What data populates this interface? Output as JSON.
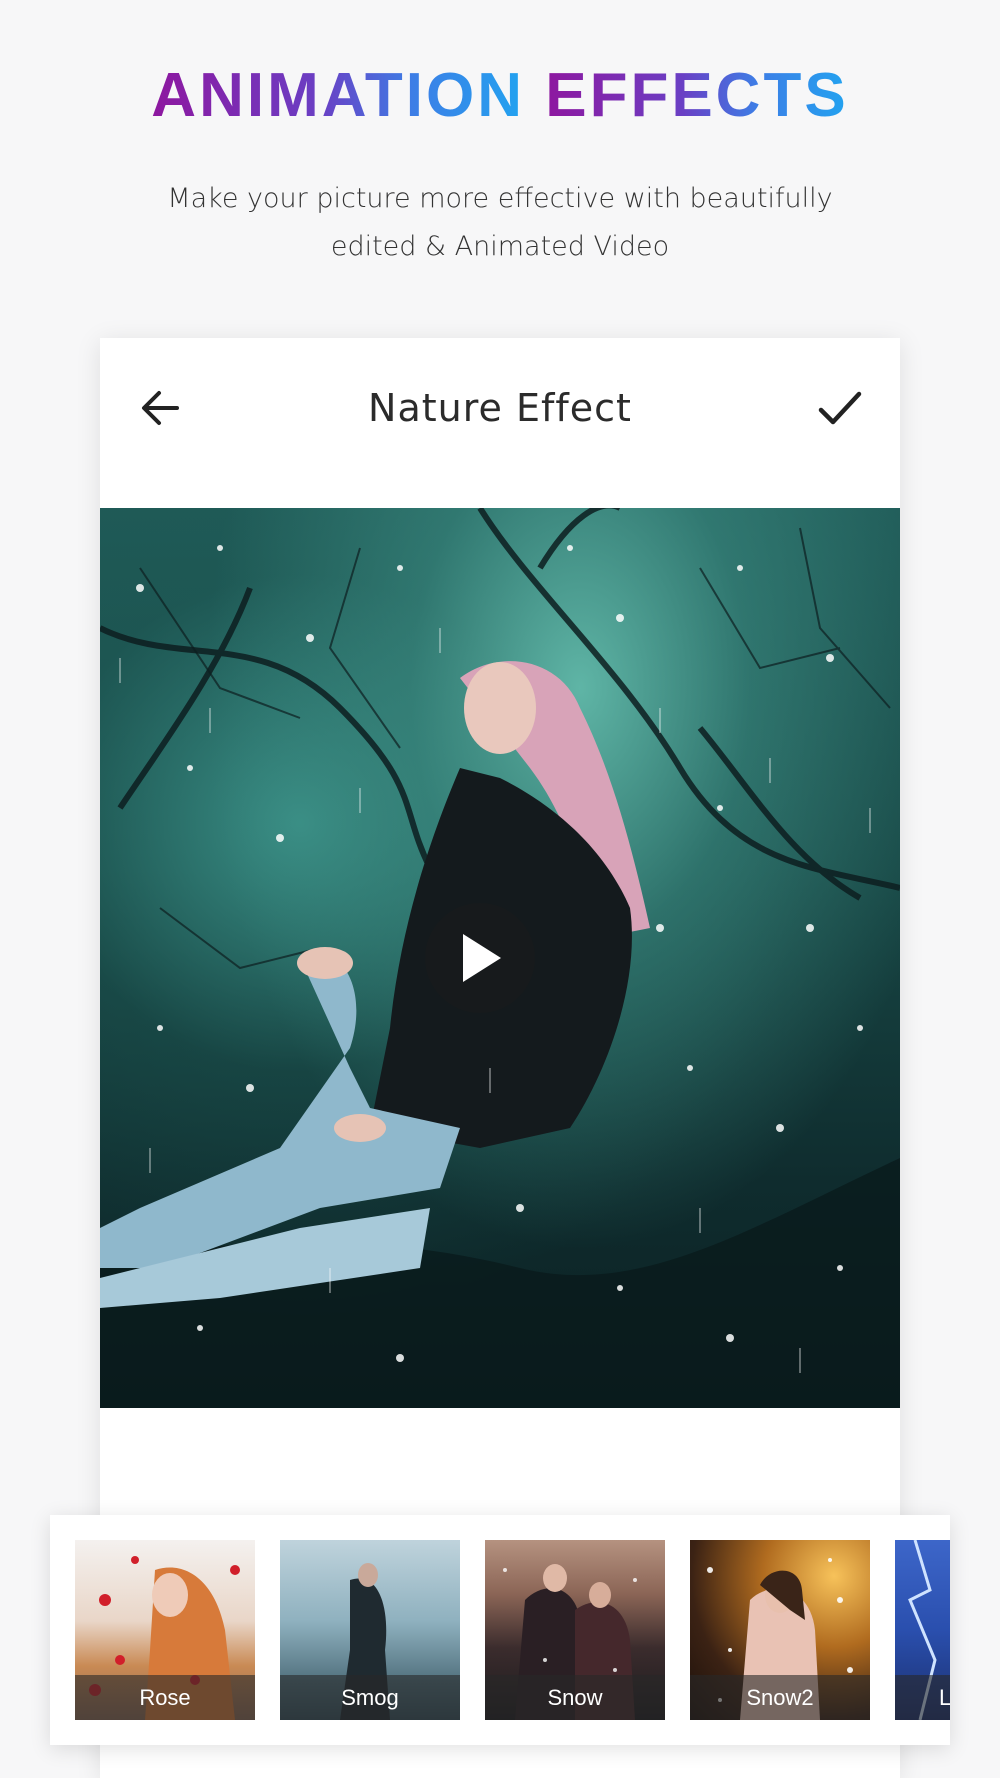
{
  "header": {
    "title_part1": "ANIMATION",
    "title_part2": "EFFECTS",
    "subtitle_line1": "Make your picture more effective with beautifully",
    "subtitle_line2": "edited & Animated Video"
  },
  "screen": {
    "title": "Nature Effect",
    "back_icon": "arrow-left-icon",
    "confirm_icon": "check-icon",
    "play_icon": "play-icon"
  },
  "effects": [
    {
      "label": "Rose"
    },
    {
      "label": "Smog"
    },
    {
      "label": "Snow"
    },
    {
      "label": "Snow2"
    },
    {
      "label": "Li"
    }
  ],
  "colors": {
    "title_gradient_start": "#8e179f",
    "title_gradient_end": "#22a3f0",
    "background": "#f7f7f8"
  }
}
